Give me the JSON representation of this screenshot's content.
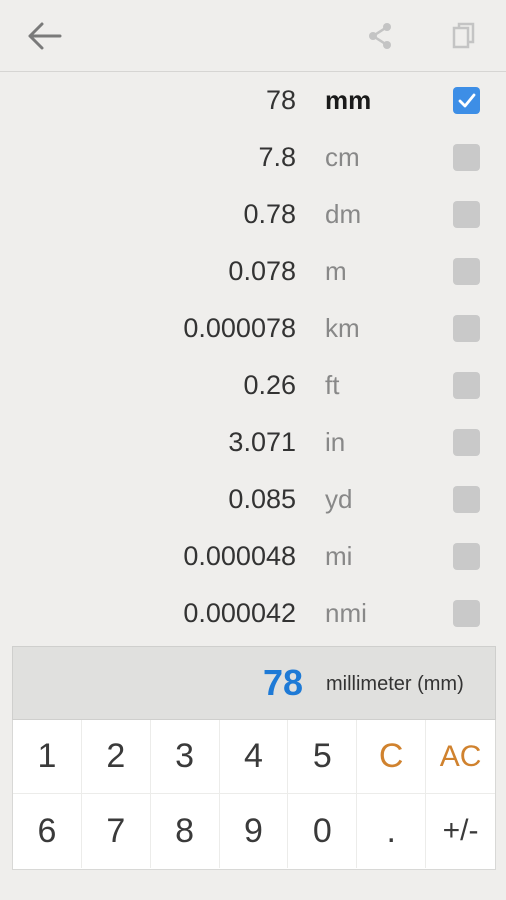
{
  "toolbar": {
    "back_icon": "arrow-left-icon",
    "share_icon": "share-icon",
    "copy_icon": "copy-icon"
  },
  "conversions": [
    {
      "value": "78",
      "unit": "mm",
      "selected": true
    },
    {
      "value": "7.8",
      "unit": "cm",
      "selected": false
    },
    {
      "value": "0.78",
      "unit": "dm",
      "selected": false
    },
    {
      "value": "0.078",
      "unit": "m",
      "selected": false
    },
    {
      "value": "0.000078",
      "unit": "km",
      "selected": false
    },
    {
      "value": "0.26",
      "unit": "ft",
      "selected": false
    },
    {
      "value": "3.071",
      "unit": "in",
      "selected": false
    },
    {
      "value": "0.085",
      "unit": "yd",
      "selected": false
    },
    {
      "value": "0.000048",
      "unit": "mi",
      "selected": false
    },
    {
      "value": "0.000042",
      "unit": "nmi",
      "selected": false
    }
  ],
  "display": {
    "value": "78",
    "unit_name": "millimeter (mm)"
  },
  "keypad": {
    "row1": [
      "1",
      "2",
      "3",
      "4",
      "5",
      "C",
      "AC"
    ],
    "row2": [
      "6",
      "7",
      "8",
      "9",
      "0",
      ".",
      "+/-"
    ]
  },
  "colors": {
    "background": "#efeeec",
    "accent_blue": "#1e7ad6",
    "checkbox_on": "#3d8ee6",
    "key_accent": "#d0822e"
  }
}
